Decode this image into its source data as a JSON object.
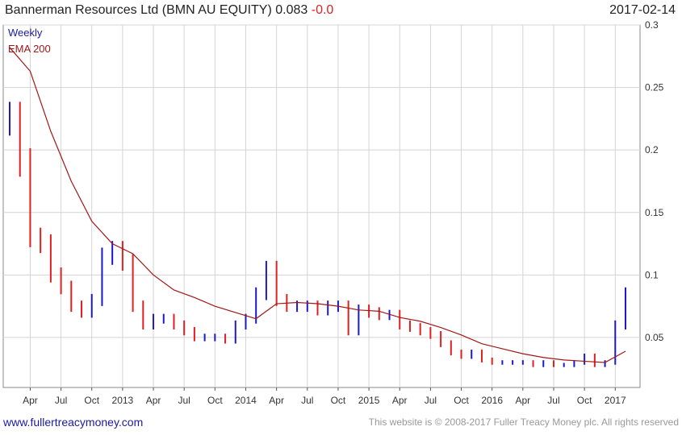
{
  "header": {
    "title": "Bannerman Resources Ltd (BMN AU EQUITY)",
    "price": "0.083",
    "change": "-0.0",
    "date": "2017-02-14"
  },
  "footer": {
    "site": "www.fullertreacymoney.com",
    "notice": "This website is © 2008-2017 Fuller Treacy Money plc. All rights reserved"
  },
  "colors": {
    "up": "#1a1acc",
    "down": "#e02020",
    "ema": "#a01818",
    "grid": "#d4d4d4",
    "axis": "#555555"
  },
  "chart_data": {
    "type": "line",
    "title": "Bannerman Resources Ltd (BMN AU EQUITY) 0.083 -0.0",
    "legend": [
      "Weekly",
      "EMA 200"
    ],
    "legend_position": "top-left",
    "grid": true,
    "ylim": [
      0.01,
      0.3
    ],
    "y_ticks": [
      "0.05",
      "0.1",
      "0.15",
      "0.2",
      "0.25",
      "0.3"
    ],
    "x_ticks": [
      "Apr",
      "Jul",
      "Oct",
      "2013",
      "Apr",
      "Jul",
      "Oct",
      "2014",
      "Apr",
      "Jul",
      "Oct",
      "2015",
      "Apr",
      "Jul",
      "Oct",
      "2016",
      "Apr",
      "Jul",
      "Oct",
      "2017"
    ],
    "x_range": [
      "2012-02",
      "2017-02"
    ],
    "series": [
      {
        "name": "Weekly",
        "style": "bars",
        "x": [
          "2012-02",
          "2012-03",
          "2012-04",
          "2012-05",
          "2012-06",
          "2012-07",
          "2012-08",
          "2012-09",
          "2012-10",
          "2012-11",
          "2012-12",
          "2013-01",
          "2013-02",
          "2013-03",
          "2013-04",
          "2013-05",
          "2013-06",
          "2013-07",
          "2013-08",
          "2013-09",
          "2013-10",
          "2013-11",
          "2013-12",
          "2014-01",
          "2014-02",
          "2014-03",
          "2014-04",
          "2014-05",
          "2014-06",
          "2014-07",
          "2014-08",
          "2014-09",
          "2014-10",
          "2014-11",
          "2014-12",
          "2015-01",
          "2015-02",
          "2015-03",
          "2015-04",
          "2015-05",
          "2015-06",
          "2015-07",
          "2015-08",
          "2015-09",
          "2015-10",
          "2015-11",
          "2015-12",
          "2016-01",
          "2016-02",
          "2016-03",
          "2016-04",
          "2016-05",
          "2016-06",
          "2016-07",
          "2016-08",
          "2016-09",
          "2016-10",
          "2016-11",
          "2016-12",
          "2017-01",
          "2017-02"
        ],
        "values": [
          0.225,
          0.19,
          0.13,
          0.125,
          0.1,
          0.09,
          0.075,
          0.07,
          0.08,
          0.115,
          0.12,
          0.11,
          0.075,
          0.06,
          0.065,
          0.065,
          0.06,
          0.055,
          0.05,
          0.05,
          0.05,
          0.048,
          0.06,
          0.065,
          0.085,
          0.105,
          0.08,
          0.075,
          0.075,
          0.075,
          0.072,
          0.075,
          0.075,
          0.055,
          0.072,
          0.07,
          0.068,
          0.068,
          0.06,
          0.058,
          0.055,
          0.052,
          0.045,
          0.038,
          0.035,
          0.038,
          0.032,
          0.03,
          0.03,
          0.03,
          0.03,
          0.028,
          0.03,
          0.028,
          0.028,
          0.03,
          0.035,
          0.028,
          0.03,
          0.06,
          0.085
        ]
      },
      {
        "name": "EMA 200",
        "style": "line",
        "x": [
          "2012-02",
          "2012-04",
          "2012-06",
          "2012-08",
          "2012-10",
          "2012-12",
          "2013-02",
          "2013-04",
          "2013-06",
          "2013-08",
          "2013-10",
          "2013-12",
          "2014-02",
          "2014-04",
          "2014-06",
          "2014-08",
          "2014-10",
          "2014-12",
          "2015-02",
          "2015-04",
          "2015-06",
          "2015-08",
          "2015-10",
          "2015-12",
          "2016-02",
          "2016-04",
          "2016-06",
          "2016-08",
          "2016-10",
          "2016-12",
          "2017-02"
        ],
        "values": [
          0.282,
          0.263,
          0.215,
          0.175,
          0.143,
          0.125,
          0.117,
          0.1,
          0.088,
          0.082,
          0.075,
          0.07,
          0.065,
          0.077,
          0.078,
          0.077,
          0.075,
          0.072,
          0.071,
          0.066,
          0.063,
          0.058,
          0.052,
          0.045,
          0.041,
          0.037,
          0.034,
          0.032,
          0.031,
          0.03,
          0.039
        ]
      }
    ]
  }
}
